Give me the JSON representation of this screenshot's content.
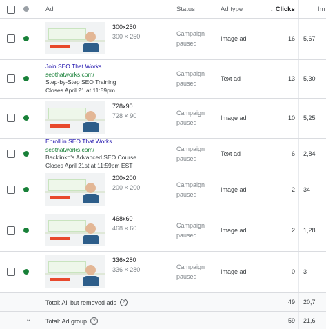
{
  "header": {
    "ad": "Ad",
    "status": "Status",
    "ad_type": "Ad type",
    "clicks": "Clicks",
    "impr": "Im"
  },
  "rows": [
    {
      "kind": "image",
      "size": "300x250",
      "size_sub": "300 × 250",
      "status": "Campaign paused",
      "ad_type": "Image ad",
      "clicks": "16",
      "impr": "5,67"
    },
    {
      "kind": "text",
      "line1": "Join SEO That Works",
      "line2": "seothatworks.com/",
      "line3": "Step-by-Step SEO Training",
      "line4": "Closes April 21 at 11:59pm",
      "status": "Campaign paused",
      "ad_type": "Text ad",
      "clicks": "13",
      "impr": "5,30"
    },
    {
      "kind": "image",
      "size": "728x90",
      "size_sub": "728 × 90",
      "status": "Campaign paused",
      "ad_type": "Image ad",
      "clicks": "10",
      "impr": "5,25"
    },
    {
      "kind": "text",
      "line1": "Enroll in SEO That Works",
      "line2": "seothatworks.com/",
      "line3": "Backlinko's Advanced SEO Course",
      "line4": "Closes April 21st at 11:59pm EST",
      "status": "Campaign paused",
      "ad_type": "Text ad",
      "clicks": "6",
      "impr": "2,84"
    },
    {
      "kind": "image",
      "size": "200x200",
      "size_sub": "200 × 200",
      "status": "Campaign paused",
      "ad_type": "Image ad",
      "clicks": "2",
      "impr": "34"
    },
    {
      "kind": "image",
      "size": "468x60",
      "size_sub": "468 × 60",
      "status": "Campaign paused",
      "ad_type": "Image ad",
      "clicks": "2",
      "impr": "1,28"
    },
    {
      "kind": "image",
      "size": "336x280",
      "size_sub": "336 × 280",
      "status": "Campaign paused",
      "ad_type": "Image ad",
      "clicks": "0",
      "impr": "3"
    }
  ],
  "totals": [
    {
      "label": "Total: All but removed ads",
      "clicks": "49",
      "impr": "20,7"
    },
    {
      "label": "Total: Ad group",
      "clicks": "59",
      "impr": "21,6"
    }
  ],
  "icons": {
    "sort": "arrow-down-icon",
    "help": "help-circle-icon",
    "expand": "chevron-down-icon"
  },
  "colors": {
    "enabled_dot": "#188038",
    "link": "#1a0dab",
    "url": "#188038"
  }
}
